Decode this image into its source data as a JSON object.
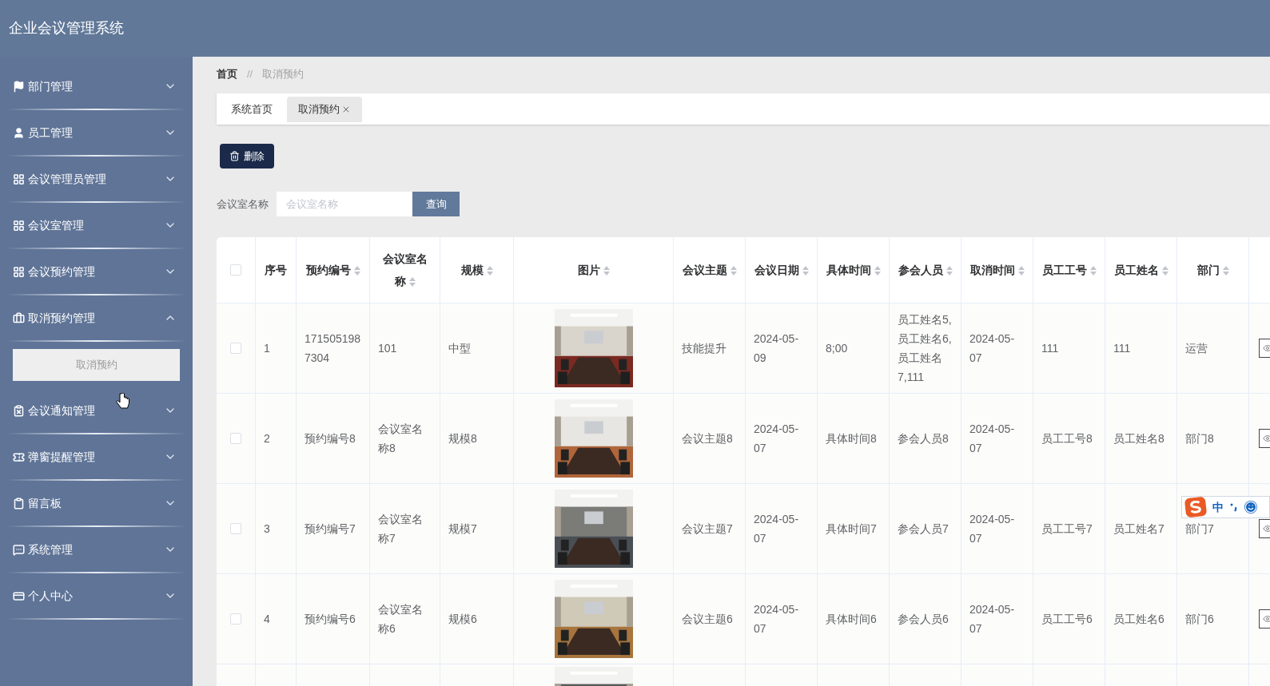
{
  "header": {
    "title": "企业会议管理系统"
  },
  "sidebar": {
    "items": [
      {
        "label": "部门管理",
        "expanded": false
      },
      {
        "label": "员工管理",
        "expanded": false
      },
      {
        "label": "会议管理员管理",
        "expanded": false
      },
      {
        "label": "会议室管理",
        "expanded": false
      },
      {
        "label": "会议预约管理",
        "expanded": false
      },
      {
        "label": "取消预约管理",
        "expanded": true,
        "children": [
          {
            "label": "取消预约",
            "selected": true
          }
        ]
      },
      {
        "label": "会议通知管理",
        "expanded": false
      },
      {
        "label": "弹窗提醒管理",
        "expanded": false
      },
      {
        "label": "留言板",
        "expanded": false
      },
      {
        "label": "系统管理",
        "expanded": false
      },
      {
        "label": "个人中心",
        "expanded": false
      }
    ]
  },
  "breadcrumb": {
    "separator": "//",
    "items": [
      "首页",
      "取消预约"
    ]
  },
  "tabs": [
    {
      "label": "系统首页",
      "selected": false,
      "closable": false
    },
    {
      "label": "取消预约",
      "selected": true,
      "closable": true
    }
  ],
  "toolbar": {
    "delete_button": "删除"
  },
  "search": {
    "label": "会议室名称",
    "placeholder": "会议室名称",
    "button": "查询"
  },
  "table": {
    "header_checked": false,
    "columns": [
      {
        "label": "序号",
        "sortable": false
      },
      {
        "label": "预约编号",
        "sortable": true
      },
      {
        "label": "会议室名称",
        "sortable": true
      },
      {
        "label": "规模",
        "sortable": true
      },
      {
        "label": "图片",
        "sortable": true
      },
      {
        "label": "会议主题",
        "sortable": true
      },
      {
        "label": "会议日期",
        "sortable": true
      },
      {
        "label": "具体时间",
        "sortable": true
      },
      {
        "label": "参会人员",
        "sortable": true
      },
      {
        "label": "取消时间",
        "sortable": true
      },
      {
        "label": "员工工号",
        "sortable": true
      },
      {
        "label": "员工姓名",
        "sortable": true
      },
      {
        "label": "部门",
        "sortable": true
      }
    ],
    "rows": [
      {
        "checked": false,
        "cells": [
          "1",
          "1715051987304",
          "101",
          "中型",
          null,
          "技能提升",
          "2024-05-09",
          "8;00",
          "员工姓名5,员工姓名6,员工姓名7,111",
          "2024-05-07",
          "111",
          "111",
          "运营"
        ]
      },
      {
        "checked": false,
        "cells": [
          "2",
          "预约编号8",
          "会议室名称8",
          "规模8",
          null,
          "会议主题8",
          "2024-05-07",
          "具体时间8",
          "参会人员8",
          "2024-05-07",
          "员工工号8",
          "员工姓名8",
          "部门8"
        ]
      },
      {
        "checked": false,
        "cells": [
          "3",
          "预约编号7",
          "会议室名称7",
          "规模7",
          null,
          "会议主题7",
          "2024-05-07",
          "具体时间7",
          "参会人员7",
          "2024-05-07",
          "员工工号7",
          "员工姓名7",
          "部门7"
        ]
      },
      {
        "checked": false,
        "cells": [
          "4",
          "预约编号6",
          "会议室名称6",
          "规模6",
          null,
          "会议主题6",
          "2024-05-07",
          "具体时间6",
          "参会人员6",
          "2024-05-07",
          "员工工号6",
          "员工姓名6",
          "部门6"
        ]
      },
      {
        "partial": true
      }
    ]
  },
  "ime_toolbar": {
    "mode": "中"
  }
}
